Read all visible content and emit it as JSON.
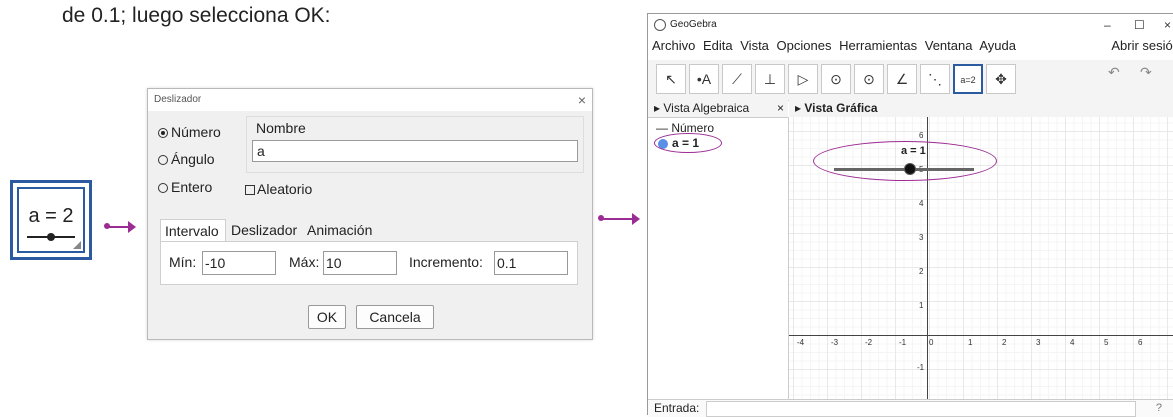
{
  "caption": "de 0.1; luego selecciona OK:",
  "tool_icon": {
    "label": "a = 2",
    "icon": "slider-tool-icon"
  },
  "dialog": {
    "title": "Deslizador",
    "close": "×",
    "radios": [
      "Número",
      "Ángulo",
      "Entero"
    ],
    "selected_radio": "Número",
    "name_label": "Nombre",
    "name_value": "a",
    "random_label": "Aleatorio",
    "tabs": [
      "Intervalo",
      "Deslizador",
      "Animación"
    ],
    "active_tab": "Intervalo",
    "min_label": "Mín:",
    "min_value": "-10",
    "max_label": "Máx:",
    "max_value": "10",
    "inc_label": "Incremento:",
    "inc_value": "0.1",
    "ok": "OK",
    "cancel": "Cancela"
  },
  "geogebra": {
    "title": "GeoGebra",
    "window_buttons": [
      "–",
      "☐",
      "×"
    ],
    "menu": [
      "Archivo",
      "Edita",
      "Vista",
      "Opciones",
      "Herramientas",
      "Ventana",
      "Ayuda"
    ],
    "sign_in": "Abrir sesión",
    "tools": [
      "↖",
      "•A",
      "⟋",
      "⊥",
      "▷",
      "⊙",
      "⊙",
      "∠",
      "⋱",
      "a=2",
      "✥"
    ],
    "algebra_view": "Vista Algebraica",
    "graphics_view": "Vista Gráfica",
    "alg_category": "Número",
    "alg_item": "a = 1",
    "slider_label": "a = 1",
    "x_ticks": [
      "-4",
      "-3",
      "-2",
      "-1",
      "0",
      "1",
      "2",
      "3",
      "4",
      "5",
      "6"
    ],
    "y_ticks": [
      "6",
      "5",
      "4",
      "3",
      "2",
      "1",
      "-1"
    ],
    "input_label": "Entrada:",
    "help": "?"
  },
  "colors": {
    "accent": "#9b2c94",
    "tool_border": "#2c5aa0",
    "point": "#5b8ee6"
  }
}
